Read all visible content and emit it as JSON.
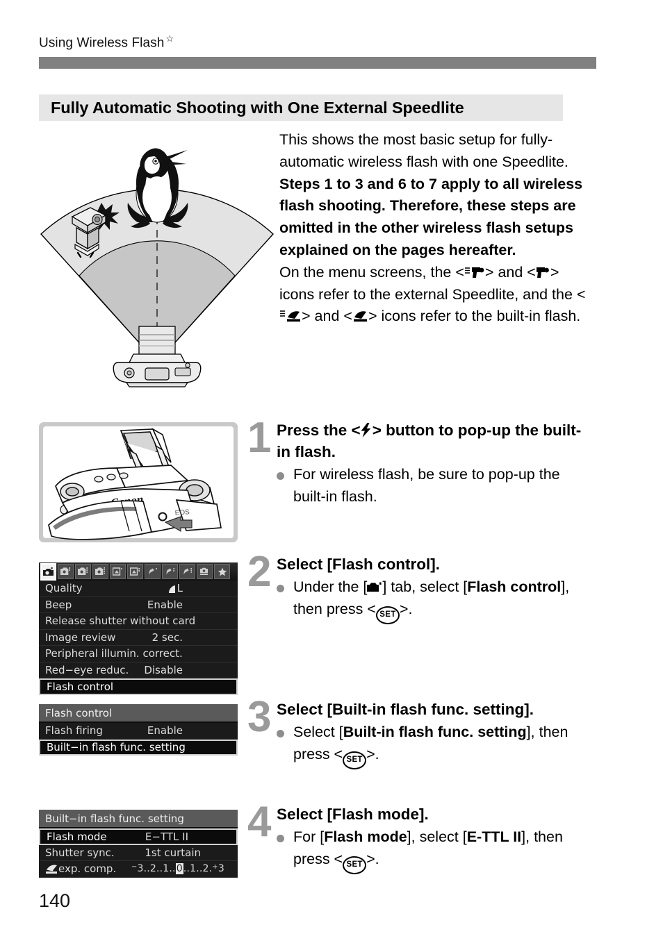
{
  "running_head": {
    "text": "Using Wireless Flash",
    "star_icon": "star-outline-icon"
  },
  "section": {
    "title": "Fully Automatic Shooting with One External Speedlite"
  },
  "intro": {
    "para1": "This shows the most basic setup for fully-automatic wireless flash with one Speedlite.",
    "para2_bold": "Steps 1 to 3 and 6 to 7 apply to all wireless flash shooting. Therefore, these steps are omitted in the other wireless flash setups explained on the pages hereafter.",
    "para3_a": "On the menu screens, the <",
    "para3_b": "> and <",
    "para3_c": "> icons refer to the external Speedlite, and the <",
    "para3_d": "> and <",
    "para3_e": "> icons refer to the built-in flash.",
    "icon_external_wireless": "external-speedlite-wireless-icon",
    "icon_external": "external-speedlite-icon",
    "icon_builtin_wireless": "built-in-flash-wireless-icon",
    "icon_builtin": "built-in-flash-icon"
  },
  "diagram": {
    "name": "wireless-flash-coverage-diagram",
    "subject_icon": "penguin-subject-icon",
    "speedlite_icon": "external-speedlite-illustration",
    "camera_icon": "camera-with-popup-flash-illustration"
  },
  "steps": [
    {
      "number": "1",
      "heading_a": "Press the <",
      "heading_icon": "flash-bolt-icon",
      "heading_b": "> button to pop-up the built-in flash.",
      "bullet": "For wireless flash, be sure to pop-up the built-in flash.",
      "figure": "camera-flash-button-photo"
    },
    {
      "number": "2",
      "heading": "Select [Flash control].",
      "bullet_a": "Under the [",
      "bullet_tab_icon": "shooting-tab-1-icon",
      "bullet_b": "] tab, select [",
      "bullet_bold": "Flash control",
      "bullet_c": "], then press <",
      "bullet_set": "SET",
      "bullet_d": ">."
    },
    {
      "number": "3",
      "heading": "Select [Built-in flash func. setting].",
      "bullet_a": "Select [",
      "bullet_bold": "Built-in flash func. setting",
      "bullet_b": "], then press <",
      "bullet_set": "SET",
      "bullet_c": ">."
    },
    {
      "number": "4",
      "heading": "Select [Flash mode].",
      "bullet_a": "For [",
      "bullet_bold1": "Flash mode",
      "bullet_b": "], select [",
      "bullet_bold2": "E-TTL II",
      "bullet_c": "], then press <",
      "bullet_set": "SET",
      "bullet_d": ">."
    }
  ],
  "lcd_shooting_menu": {
    "name": "camera-shooting-menu-screen",
    "tabs": [
      {
        "icon": "shooting-tab-1-icon",
        "selected": true
      },
      {
        "icon": "shooting-tab-2-icon",
        "selected": false
      },
      {
        "icon": "shooting-tab-3-icon",
        "selected": false
      },
      {
        "icon": "shooting-tab-4-icon",
        "selected": false
      },
      {
        "icon": "playback-tab-1-icon",
        "selected": false
      },
      {
        "icon": "playback-tab-2-icon",
        "selected": false
      },
      {
        "icon": "setup-tab-1-icon",
        "selected": false
      },
      {
        "icon": "setup-tab-2-icon",
        "selected": false
      },
      {
        "icon": "setup-tab-3-icon",
        "selected": false
      },
      {
        "icon": "custom-functions-tab-icon",
        "selected": false
      },
      {
        "icon": "my-menu-tab-icon",
        "selected": false
      }
    ],
    "rows": [
      {
        "label": "Quality",
        "value": "L",
        "value_icon": "fine-quality-icon",
        "highlighted": false
      },
      {
        "label": "Beep",
        "value": "Enable",
        "highlighted": false
      },
      {
        "label": "Release shutter without card",
        "value": "",
        "highlighted": false
      },
      {
        "label": "Image review",
        "value": "2 sec.",
        "highlighted": false
      },
      {
        "label": "Peripheral illumin. correct.",
        "value": "",
        "highlighted": false
      },
      {
        "label": "Red−eye reduc.",
        "value": "Disable",
        "highlighted": false
      },
      {
        "label": "Flash control",
        "value": "",
        "highlighted": true
      }
    ]
  },
  "lcd_flash_control": {
    "name": "flash-control-menu-screen",
    "title": "Flash control",
    "rows": [
      {
        "label": "Flash firing",
        "value": "Enable",
        "highlighted": false
      },
      {
        "label": "Built−in flash func. setting",
        "value": "",
        "highlighted": true
      }
    ]
  },
  "lcd_builtin_flash": {
    "name": "built-in-flash-func-setting-screen",
    "title": "Built−in flash func. setting",
    "rows": [
      {
        "label": "Flash mode",
        "value": "E−TTL II",
        "highlighted": true
      },
      {
        "label": "Shutter sync.",
        "value": "1st curtain",
        "highlighted": false
      },
      {
        "label": "exp. comp.",
        "label_icon": "built-in-flash-icon",
        "value": "−3..2..1..0..1..2.+3",
        "scale": true,
        "highlighted": false
      }
    ]
  },
  "page_number": "140",
  "colors": {
    "rule_gray": "#808080",
    "section_bg": "#e6e6e6",
    "step_number": "#9a9a9a",
    "bullet_dot": "#8d8d8d",
    "lcd_bg": "#1b1b1b",
    "lcd_title_bg": "#5a5a5a",
    "photo_bg": "#c9c9c9"
  }
}
